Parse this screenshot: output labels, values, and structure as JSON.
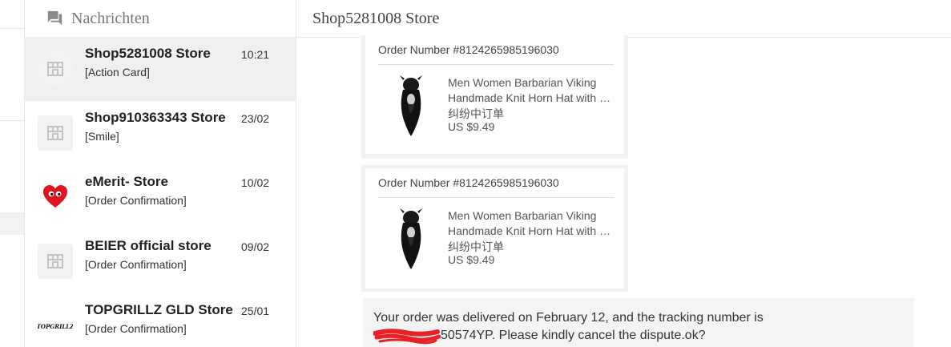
{
  "sidebar": {
    "title": "Nachrichten",
    "conversations": [
      {
        "name": "Shop5281008 Store",
        "time": "10:21",
        "preview": "[Action Card]",
        "avatar": "store-icon"
      },
      {
        "name": "Shop910363343 Store",
        "time": "23/02",
        "preview": "[Smile]",
        "avatar": "store-icon"
      },
      {
        "name": "eMerit- Store",
        "time": "10/02",
        "preview": "[Order Confirmation]",
        "avatar": "heart-logo"
      },
      {
        "name": "BEIER official store",
        "time": "09/02",
        "preview": "[Order Confirmation]",
        "avatar": "store-icon"
      },
      {
        "name": "TOPGRILLZ GLD Store",
        "time": "25/01",
        "preview": "[Order Confirmation]",
        "avatar": "topgrillz-logo",
        "logo_text": "TOPGRILLZ"
      }
    ]
  },
  "chat": {
    "title": "Shop5281008 Store",
    "cards": [
      {
        "order_number": "Order Number #8124265985196030",
        "product_line1": "Men Women Barbarian Viking",
        "product_line2": "Handmade Knit Horn Hat with Beard",
        "status": "纠纷中订单",
        "price": "US $9.49"
      },
      {
        "order_number": "Order Number #8124265985196030",
        "product_line1": "Men Women Barbarian Viking",
        "product_line2": "Handmade Knit Horn Hat with Beard",
        "status": "纠纷中订单",
        "price": "US $9.49"
      }
    ],
    "message": {
      "line1": "Your order was delivered on February 12, and the tracking number is",
      "line2_visible": "50574YP. Please kindly cancel the dispute.ok?"
    }
  },
  "colors": {
    "active_row": "#f0f0f0",
    "redaction": "#e8202a",
    "heart": "#e0141e"
  }
}
